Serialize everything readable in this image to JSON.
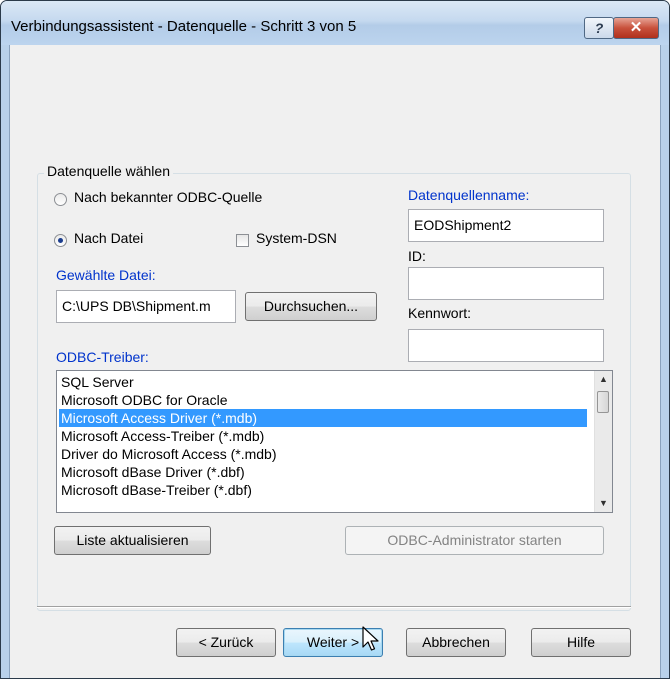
{
  "window": {
    "title": "Verbindungsassistent - Datenquelle - Schritt 3 von 5",
    "help_glyph": "?",
    "close_glyph": "✕"
  },
  "group": {
    "legend": "Datenquelle wählen",
    "radio_known_odbc": {
      "label": "Nach bekannter ODBC-Quelle",
      "checked": false
    },
    "radio_file": {
      "label": "Nach Datei",
      "checked": true
    },
    "checkbox_system_dsn": {
      "label": "System-DSN",
      "checked": false
    },
    "selected_file_label": "Gewählte Datei:",
    "selected_file_value": "C:\\UPS DB\\Shipment.m",
    "browse_button": "Durchsuchen...",
    "dsn_name_label": "Datenquellenname:",
    "dsn_name_value": "EODShipment2",
    "id_label": "ID:",
    "id_value": "",
    "password_label": "Kennwort:",
    "password_value": "",
    "odbc_driver_label": "ODBC-Treiber:",
    "drivers": [
      "SQL Server",
      "Microsoft ODBC for Oracle",
      "Microsoft Access Driver (*.mdb)",
      "Microsoft Access-Treiber (*.mdb)",
      "Driver do Microsoft Access (*.mdb)",
      "Microsoft dBase Driver (*.dbf)",
      "Microsoft dBase-Treiber (*.dbf)"
    ],
    "selected_driver_index": 2,
    "refresh_button": "Liste aktualisieren",
    "odbc_admin_button": "ODBC-Administrator starten"
  },
  "footer": {
    "back_button": "< Zurück",
    "next_button": "Weiter >",
    "cancel_button": "Abbrechen",
    "help_button": "Hilfe"
  },
  "colors": {
    "accent_label": "#0033cc",
    "selection": "#3399ff"
  }
}
